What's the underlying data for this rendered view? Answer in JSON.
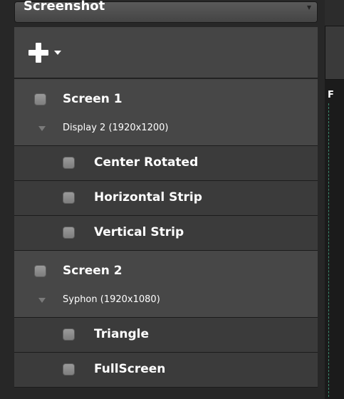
{
  "dropdown": {
    "label": "Screenshot",
    "arrow_icon": "chevron-down-icon"
  },
  "toolbar": {
    "add_icon": "plus-icon",
    "add_menu_icon": "caret-down-icon"
  },
  "screens": [
    {
      "name": "Screen 1",
      "output": "Display 2 (1920x1200)",
      "layers": [
        {
          "name": "Center Rotated"
        },
        {
          "name": "Horizontal Strip"
        },
        {
          "name": "Vertical Strip"
        }
      ]
    },
    {
      "name": "Screen 2",
      "output": "Syphon (1920x1080)",
      "layers": [
        {
          "name": "Triangle"
        },
        {
          "name": "FullScreen"
        }
      ]
    }
  ],
  "right_panel": {
    "label": "F"
  },
  "colors": {
    "panel_dark": "#272727",
    "screen_row": "#474747",
    "layer_row": "#3b3b3b",
    "guide": "#3a8a6e"
  }
}
